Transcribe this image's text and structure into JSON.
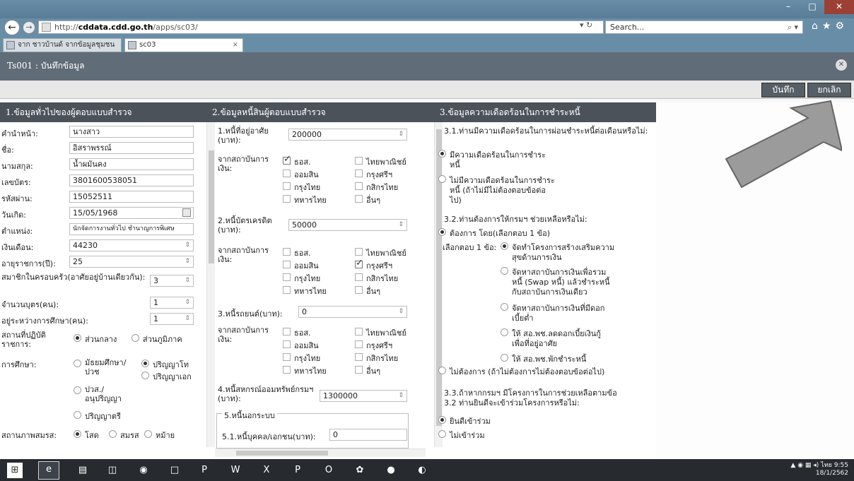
{
  "browser": {
    "address_prefix": "http://",
    "address_domain": "cddata.cdd.go.th",
    "address_path": "/apps/sc03/",
    "search_placeholder": "Search...",
    "tabs": [
      "จาก ชาวบ้านด้ จากข้อมูลชุมชน ...",
      "sc03"
    ]
  },
  "app": {
    "title": "Ts001 : บันทึกข้อมูล",
    "save_label": "บันทึก",
    "cancel_label": "ยกเลิก"
  },
  "section1": {
    "heading": "1.ข้อมูลทั่วไปของผู้ตอบแบบสำรวจ",
    "title_label": "คำนำหน้า:",
    "title_value": "นางสาว",
    "name_label": "ชื่อ:",
    "name_value": "อิสราพรรณ์",
    "surname_label": "นามสกุล:",
    "surname_value": "น้ำผมันคง",
    "id_label": "เลขบัตร:",
    "id_value": "3801600538051",
    "pass_label": "รหัสผ่าน:",
    "pass_value": "15052511",
    "birth_label": "วันเกิด:",
    "birth_value": "15/05/1968",
    "position_label": "ตำแหน่ง:",
    "position_value": "นักจัดการงานทั่วไป ชำนาญการพิเศษ",
    "salary_label": "เงินเดือน:",
    "salary_value": "44230",
    "service_label": "อายุราชการ(ปี):",
    "service_value": "25",
    "family_label": "สมาชิกในครอบครัว(อาศัยอยู่บ้านเดียวกัน):",
    "family_value": "3",
    "children_label": "จำนวนบุตร(คน):",
    "children_value": "1",
    "studying_label": "อยู่ระหว่างการศึกษา(คน):",
    "studying_value": "1",
    "workplace_label": "สถานที่ปฏิบัติราชการ:",
    "workplace_opt1": "ส่วนกลาง",
    "workplace_opt2": "ส่วนภูมิภาค",
    "edu_label": "การศึกษา:",
    "edu_opt1": "มัธยมศึกษา/ปวช",
    "edu_opt2": "ปริญญาโท",
    "edu_opt3": "ปวส./อนุปริญญา",
    "edu_opt4": "ปริญญาเอก",
    "edu_opt5": "ปริญญาตรี",
    "marital_label": "สถานภาพสมรส:",
    "marital_opt1": "โสด",
    "marital_opt2": "สมรส",
    "marital_opt3": "หม้าย"
  },
  "section2": {
    "heading": "2.ข้อมูลหนี้สินผู้ตอบแบบสำรวจ",
    "source_label": "จากสถาบันการเงิน:",
    "banks": [
      "ธอส.",
      "ไทยพาณิชย์",
      "ออมสิน",
      "กรุงศรีฯ",
      "กรุงไทย",
      "กสิกรไทย",
      "ทหารไทย",
      "อื่นๆ"
    ],
    "housing_label": "1.หนี้ที่อยู่อาศัย (บาท):",
    "housing_value": "200000",
    "credit_label": "2.หนี้บัตรเครดิต (บาท):",
    "credit_value": "50000",
    "car_label": "3.หนี้รถยนต์(บาท):",
    "car_value": "0",
    "coop_label": "4.หนี้สหกรณ์ออมทรัพย์กรมฯ (บาท):",
    "coop_value": "1300000",
    "outside_label": "5.หนี้นอกระบบ",
    "personal_label": "5.1.หนี้บุคคล/เอกชน(บาท):",
    "personal_value": "0"
  },
  "section3": {
    "heading": "3.ข้อมูลความเดือดร้อนในการชำระหนี้",
    "q1": "3.1.ท่านมีความเดือดร้อนในการผ่อนชำระหนี้ต่อเดือนหรือไม่:",
    "q1_opt1_l1": "มีความเดือดร้อนในการชำระ",
    "q1_opt1_l2": "หนี้",
    "q1_opt2_l1": "ไม่มีความเดือดร้อนในการชำระ",
    "q1_opt2_l2": "หนี้ (ถ้าไม่มีไม่ต้องตอบข้อต่อ",
    "q1_opt2_l3": "ไป)",
    "q2": "3.2.ท่านต้องการให้กรมฯ ช่วยเหลือหรือไม่:",
    "q2_opt1": "ต้องการ โดย(เลือกตอบ 1 ข้อ)",
    "choose_label": "เลือกตอบ 1 ข้อ:",
    "c1_l1": "จัดทำโครงการสร้างเสริมความ",
    "c1_l2": "สุขด้านการเงิน",
    "c2_l1": "จัดหาสถาบันการเงินเพื่อรวม",
    "c2_l2": "หนี้ (Swap หนี้) แล้วชำระหนี้",
    "c2_l3": "กับสถาบันการเงินเดียว",
    "c3_l1": "จัดหาสถาบันการเงินที่มีดอก",
    "c3_l2": "เบี้ยต่ำ",
    "c4_l1": "ให้ สอ.พช.ลดดอกเบี้ยเงินกู้",
    "c4_l2": "เพื่อที่อยู่อาศัย",
    "c5": "ให้ สอ.พช.พักชำระหนี้",
    "q2_opt2": "ไม่ต้องการ (ถ้าไม่ต้องการไม่ต้องตอบข้อต่อไป)",
    "q3_l1": "3.3.ถ้าหากกรมฯ มีโครงการในการช่วยเหลือตามข้อ",
    "q3_l2": "3.2 ท่านยินดีจะเข้าร่วมโครงการหรือไม่:",
    "q3_opt1": "ยินดีเข้าร่วม",
    "q3_opt2": "ไม่เข้าร่วม"
  },
  "taskbar": {
    "time": "9:55",
    "date": "18/1/2562",
    "lang": "ไทย"
  }
}
